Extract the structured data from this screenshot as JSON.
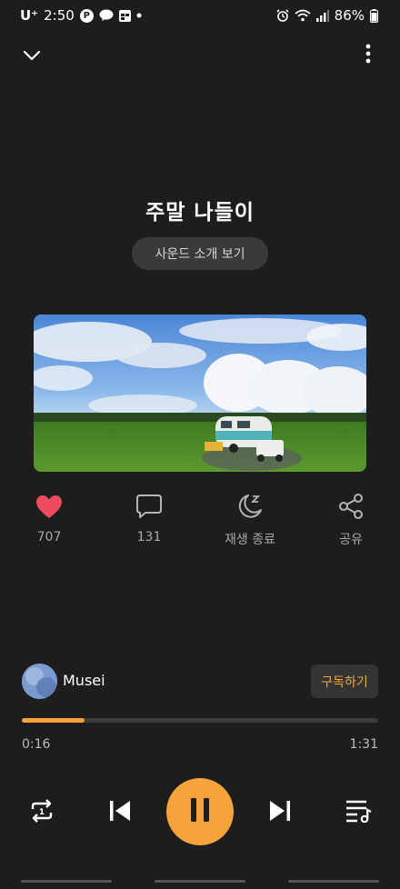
{
  "status_bar": {
    "carrier": "U⁺",
    "time": "2:50",
    "battery": "86%",
    "icons": [
      "p-circle-icon",
      "talk-bubble-icon",
      "calendar-icon",
      "dot-icon",
      "alarm-icon",
      "wifi-icon",
      "signal-icon",
      "battery-icon"
    ]
  },
  "header": {
    "collapse_icon": "chevron-down-icon",
    "more_icon": "more-vertical-icon"
  },
  "title": "주말 나들이",
  "intro_button": "사운드 소개 보기",
  "actions": [
    {
      "icon": "heart-icon",
      "label": "707",
      "color": "#ef4a5f"
    },
    {
      "icon": "comment-icon",
      "label": "131"
    },
    {
      "icon": "sleep-moon-icon",
      "label": "재생 종료"
    },
    {
      "icon": "share-icon",
      "label": "공유"
    }
  ],
  "channel": {
    "name": "Musei",
    "subscribe_label": "구독하기"
  },
  "player": {
    "current_time": "0:16",
    "total_time": "1:31",
    "progress_fraction": 0.176,
    "accent": "#f6a33c"
  },
  "controls": {
    "repeat_icon": "repeat-one-icon",
    "prev_icon": "skip-previous-icon",
    "play_icon": "pause-icon",
    "next_icon": "skip-next-icon",
    "playlist_icon": "playlist-icon"
  }
}
